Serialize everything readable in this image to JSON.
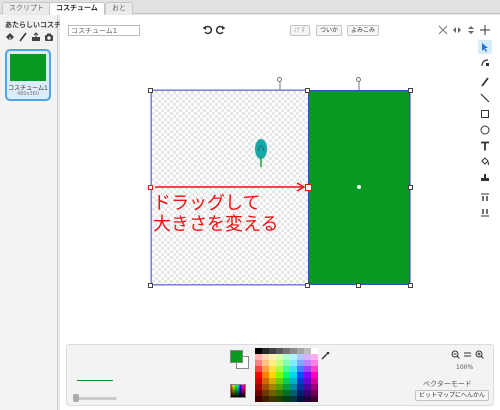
{
  "tabs": [
    {
      "label": "スクリプト"
    },
    {
      "label": "コスチューム"
    },
    {
      "label": "おと"
    }
  ],
  "left_panel": {
    "new_costume_label": "あたらしいコスチューム:",
    "icons": [
      "paint-icon",
      "pencil-icon",
      "folder-upload-icon",
      "camera-icon"
    ],
    "costume": {
      "name": "コスチューム1",
      "size": "480x360"
    }
  },
  "editor": {
    "costume_name_value": "コスチューム1",
    "buttons": {
      "clear": "けす",
      "add": "ついか",
      "import": "よみこみ"
    },
    "annotation_line1": "ドラッグして",
    "annotation_line2": "大きさを変える",
    "fill_color": "#089a22",
    "annotation_color": "#ee1111",
    "selection_color": "#3d4bb8"
  },
  "bottom": {
    "zoom_level": "100%",
    "mode_label": "ベクターモード",
    "convert_button": "ビットマップにへんかん",
    "palette": [
      "#000000",
      "#262626",
      "#404040",
      "#595959",
      "#737373",
      "#8c8c8c",
      "#a6a6a6",
      "#bfbfbf",
      "#ffffff",
      "#ffb0b0",
      "#ffd7b0",
      "#fff2b0",
      "#d9ffb0",
      "#b0ffd0",
      "#b0f2ff",
      "#b0c8ff",
      "#d6b0ff",
      "#ffb0ea",
      "#ff8080",
      "#ffc080",
      "#ffec80",
      "#c8ff80",
      "#80ffb4",
      "#80ecff",
      "#80a8ff",
      "#c080ff",
      "#ff80de",
      "#ff4040",
      "#ffa040",
      "#ffe040",
      "#a8ff40",
      "#40ff90",
      "#40e0ff",
      "#4080ff",
      "#a040ff",
      "#ff40cc",
      "#ff0000",
      "#ff8000",
      "#ffd700",
      "#80ff00",
      "#00ff66",
      "#00d7ff",
      "#0050ff",
      "#8000ff",
      "#ff00bb",
      "#d00000",
      "#d06800",
      "#d0b000",
      "#68d000",
      "#00d054",
      "#00b0d0",
      "#0040d0",
      "#6800d0",
      "#d0009a",
      "#a00000",
      "#a05000",
      "#a08800",
      "#50a000",
      "#00a040",
      "#0088a0",
      "#0030a0",
      "#5000a0",
      "#a00076",
      "#700000",
      "#703800",
      "#706000",
      "#387000",
      "#00702c",
      "#006070",
      "#002070",
      "#380070",
      "#700052",
      "#400000",
      "#402000",
      "#403600",
      "#204000",
      "#004018",
      "#003640",
      "#001240",
      "#200040",
      "#40002e"
    ]
  }
}
